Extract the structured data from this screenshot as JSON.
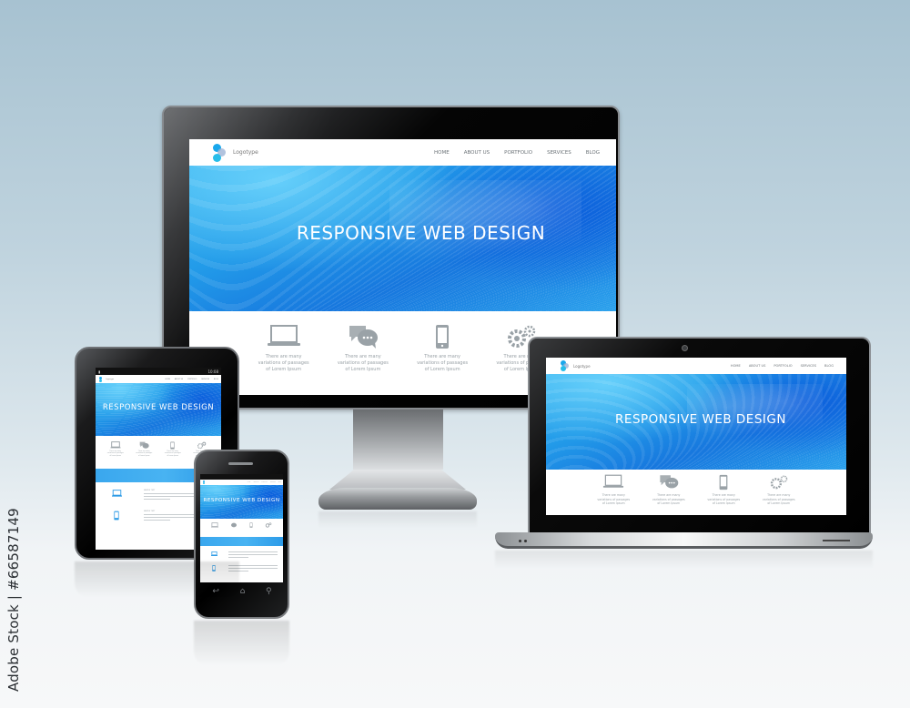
{
  "watermark": {
    "stock_id": "Adobe Stock | #66587149"
  },
  "website": {
    "logo_text": "Logotype",
    "nav": [
      "HOME",
      "ABOUT US",
      "PORTFOLIO",
      "SERVICES",
      "BLOG"
    ],
    "headline": "RESPONSIVE WEB  DESIGN",
    "features": [
      {
        "icon": "laptop-icon",
        "text": [
          "There are many",
          "variations of passages",
          "of Lorem Ipsum"
        ]
      },
      {
        "icon": "chat-bubbles-icon",
        "text": [
          "There are many",
          "variations of passages",
          "of Lorem Ipsum"
        ]
      },
      {
        "icon": "smartphone-icon",
        "text": [
          "There are many",
          "variations of passages",
          "of Lorem Ipsum"
        ]
      },
      {
        "icon": "gears-icon",
        "text": [
          "There are many",
          "variations of passages",
          "of Lorem Ipsum"
        ]
      }
    ],
    "sample_rows": [
      {
        "icon": "laptop-icon",
        "title": "SAMPLE TEXT"
      },
      {
        "icon": "smartphone-icon",
        "title": "SAMPLE TEXT"
      }
    ]
  },
  "tablet": {
    "status_time": "10:08"
  },
  "phone": {
    "keys": [
      "back-icon",
      "home-icon",
      "search-icon"
    ]
  },
  "colors": {
    "accent_blue": "#2e9be6",
    "bezel": "#000000",
    "background_top": "#a7c2d1",
    "background_bottom": "#f7f8f9"
  }
}
